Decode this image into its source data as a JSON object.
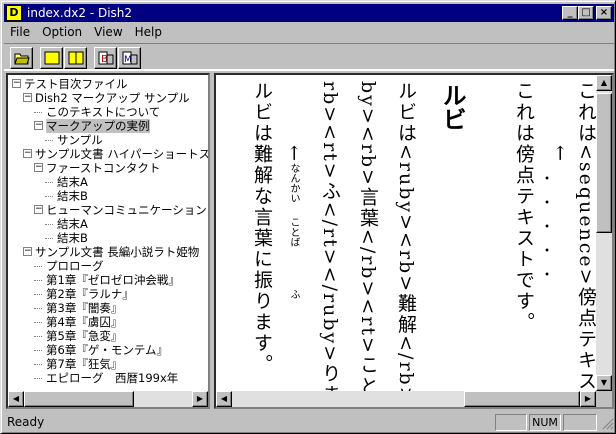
{
  "window": {
    "title": "index.dx2 - Dish2",
    "app_icon": "D"
  },
  "menu": [
    {
      "label": "File",
      "key": "F"
    },
    {
      "label": "Option",
      "key": "O"
    },
    {
      "label": "View",
      "key": "V"
    },
    {
      "label": "Help",
      "key": "H"
    }
  ],
  "tree": [
    {
      "label": "テスト目次ファイル",
      "level": 0,
      "expander": "-"
    },
    {
      "label": "Dish2 マークアップ サンプル",
      "level": 1,
      "expander": "-"
    },
    {
      "label": "このテキストについて",
      "level": 2,
      "expander": ""
    },
    {
      "label": "マークアップの実例",
      "level": 2,
      "expander": "-",
      "selected": true
    },
    {
      "label": "サンプル",
      "level": 3,
      "expander": ""
    },
    {
      "label": "サンプル文書 ハイパーショートス",
      "level": 1,
      "expander": "-"
    },
    {
      "label": "ファーストコンタクト",
      "level": 2,
      "expander": "-"
    },
    {
      "label": "結末A",
      "level": 3,
      "expander": ""
    },
    {
      "label": "結末B",
      "level": 3,
      "expander": ""
    },
    {
      "label": "ヒューマンコミュニケーション",
      "level": 2,
      "expander": "-"
    },
    {
      "label": "結末A",
      "level": 3,
      "expander": ""
    },
    {
      "label": "結末B",
      "level": 3,
      "expander": ""
    },
    {
      "label": "サンプル文書 長編小説ラト姫物",
      "level": 1,
      "expander": "-"
    },
    {
      "label": "プロローグ",
      "level": 2,
      "expander": ""
    },
    {
      "label": "第1章『ゼロゼロ沖会戦』",
      "level": 2,
      "expander": ""
    },
    {
      "label": "第2章『ラルナ』",
      "level": 2,
      "expander": ""
    },
    {
      "label": "第3章『闇奏』",
      "level": 2,
      "expander": ""
    },
    {
      "label": "第4章『虜囚』",
      "level": 2,
      "expander": ""
    },
    {
      "label": "第5章『急変』",
      "level": 2,
      "expander": ""
    },
    {
      "label": "第6章『ゲ・モンテム』",
      "level": 2,
      "expander": ""
    },
    {
      "label": "第7章『狂気』",
      "level": 2,
      "expander": ""
    },
    {
      "label": "エピローグ　西暦199x年",
      "level": 2,
      "expander": ""
    }
  ],
  "content": {
    "col1": "これは<sequence>傍点テキスト",
    "col2": "これは傍点テキストです。",
    "marks": "・・・・・",
    "arrow1": "←",
    "heading": "ルビ",
    "col3": "ルビは<ruby><rb>難解</rb><rt",
    "col4": "by><rb>言葉</rb><rt>ことば</",
    "col5": "rb><rt>ふ</rt></ruby>ります。",
    "arrow2": "←",
    "col6": "ルビは難解な言葉に振ります。",
    "ruby1": "なんかい",
    "ruby2": "ことば",
    "ruby3": "ふ"
  },
  "status": {
    "text": "Ready",
    "num": "NUM"
  }
}
